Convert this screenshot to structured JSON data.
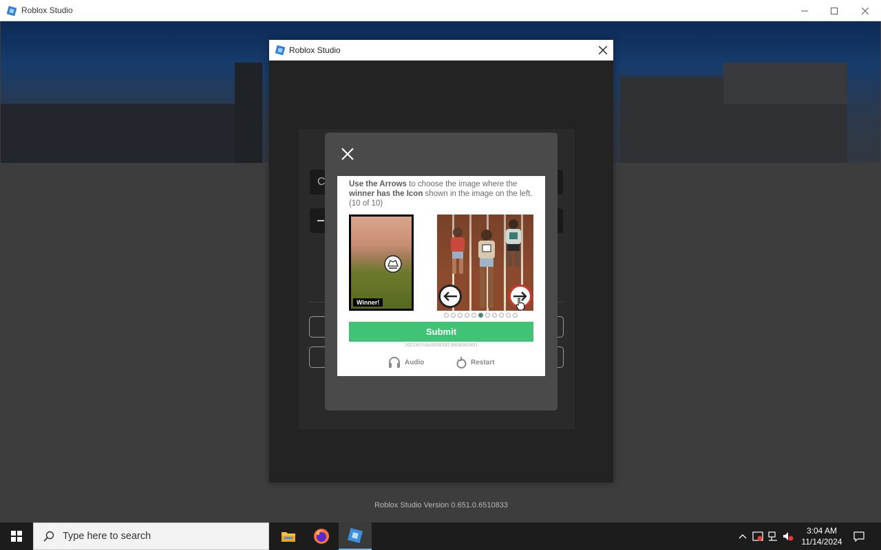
{
  "window": {
    "title": "Roblox Studio",
    "controls": [
      "minimize",
      "maximize",
      "close"
    ]
  },
  "dialog": {
    "title": "Roblox Studio",
    "username_peek": "C"
  },
  "captcha": {
    "instruction_parts": {
      "bold1": "Use the Arrows",
      "text1": " to choose the image where the ",
      "bold2": "winner has the Icon",
      "text2": " shown in the image on the left. (10 of 10)"
    },
    "reference_label": "Winner!",
    "total_dots": 11,
    "active_dot": 5,
    "submit_label": "Submit",
    "session_id": "2621907c6c8608335.8808002401",
    "audio_label": "Audio",
    "restart_label": "Restart"
  },
  "version_text": "Roblox Studio Version 0.651.0.6510833",
  "taskbar": {
    "search_placeholder": "Type here to search",
    "apps": [
      "file-explorer",
      "firefox",
      "roblox-studio"
    ],
    "time": "3:04 AM",
    "date": "11/14/2024"
  },
  "colors": {
    "submit": "#40c374",
    "active_dot": "#4a8c6a",
    "roblox_blue": "#3b8fe0",
    "taskbar": "#1c1c1c"
  }
}
